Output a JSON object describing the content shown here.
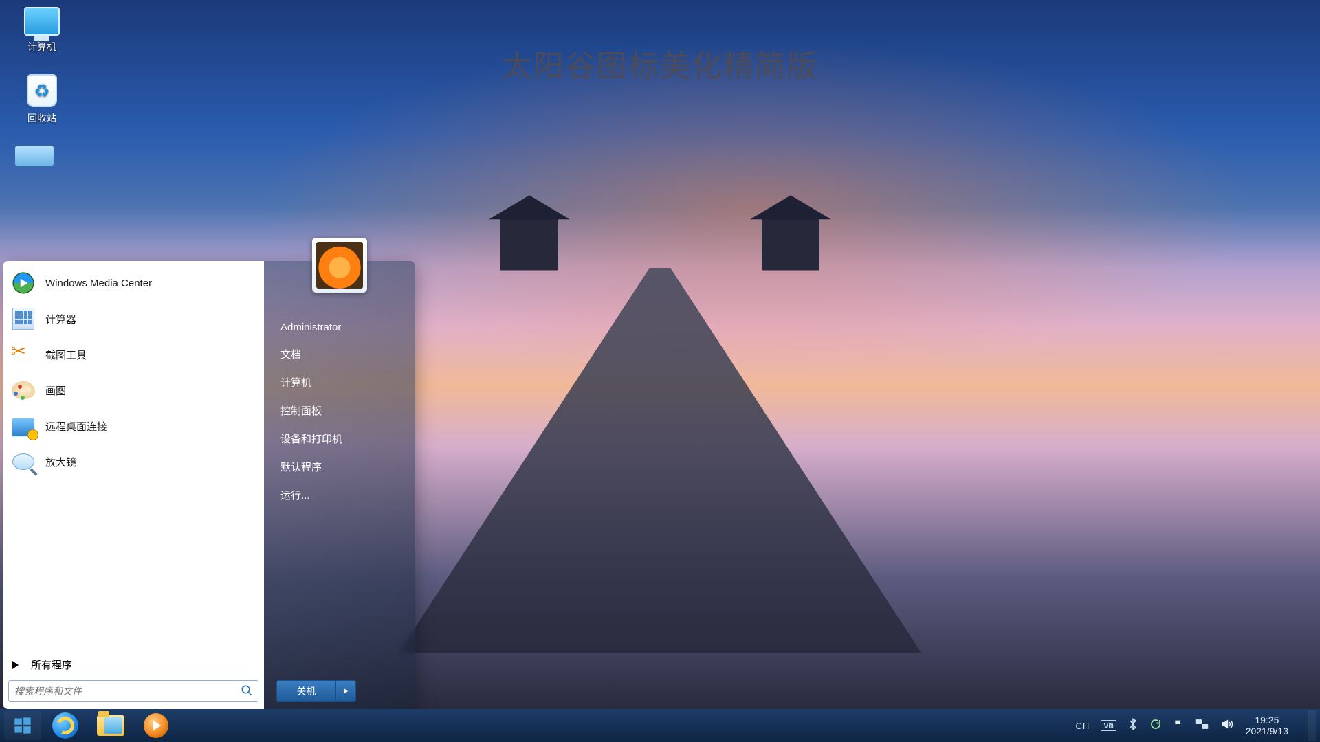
{
  "wallpaper_title": "太阳谷图标美化精简版",
  "desktop_icons": {
    "computer": "计算机",
    "recycle_bin": "回收站"
  },
  "start_menu": {
    "left_items": [
      {
        "icon": "wmc",
        "label": "Windows Media Center"
      },
      {
        "icon": "calc",
        "label": "计算器"
      },
      {
        "icon": "snip",
        "label": "截图工具"
      },
      {
        "icon": "paint",
        "label": "画图"
      },
      {
        "icon": "rdc",
        "label": "远程桌面连接"
      },
      {
        "icon": "mag",
        "label": "放大镜"
      }
    ],
    "all_programs": "所有程序",
    "search_placeholder": "搜索程序和文件",
    "user_name": "Administrator",
    "right_links": [
      "文档",
      "计算机",
      "控制面板",
      "设备和打印机",
      "默认程序",
      "运行..."
    ],
    "shutdown_label": "关机"
  },
  "tray": {
    "ime": "CH",
    "time": "19:25",
    "date": "2021/9/13"
  }
}
